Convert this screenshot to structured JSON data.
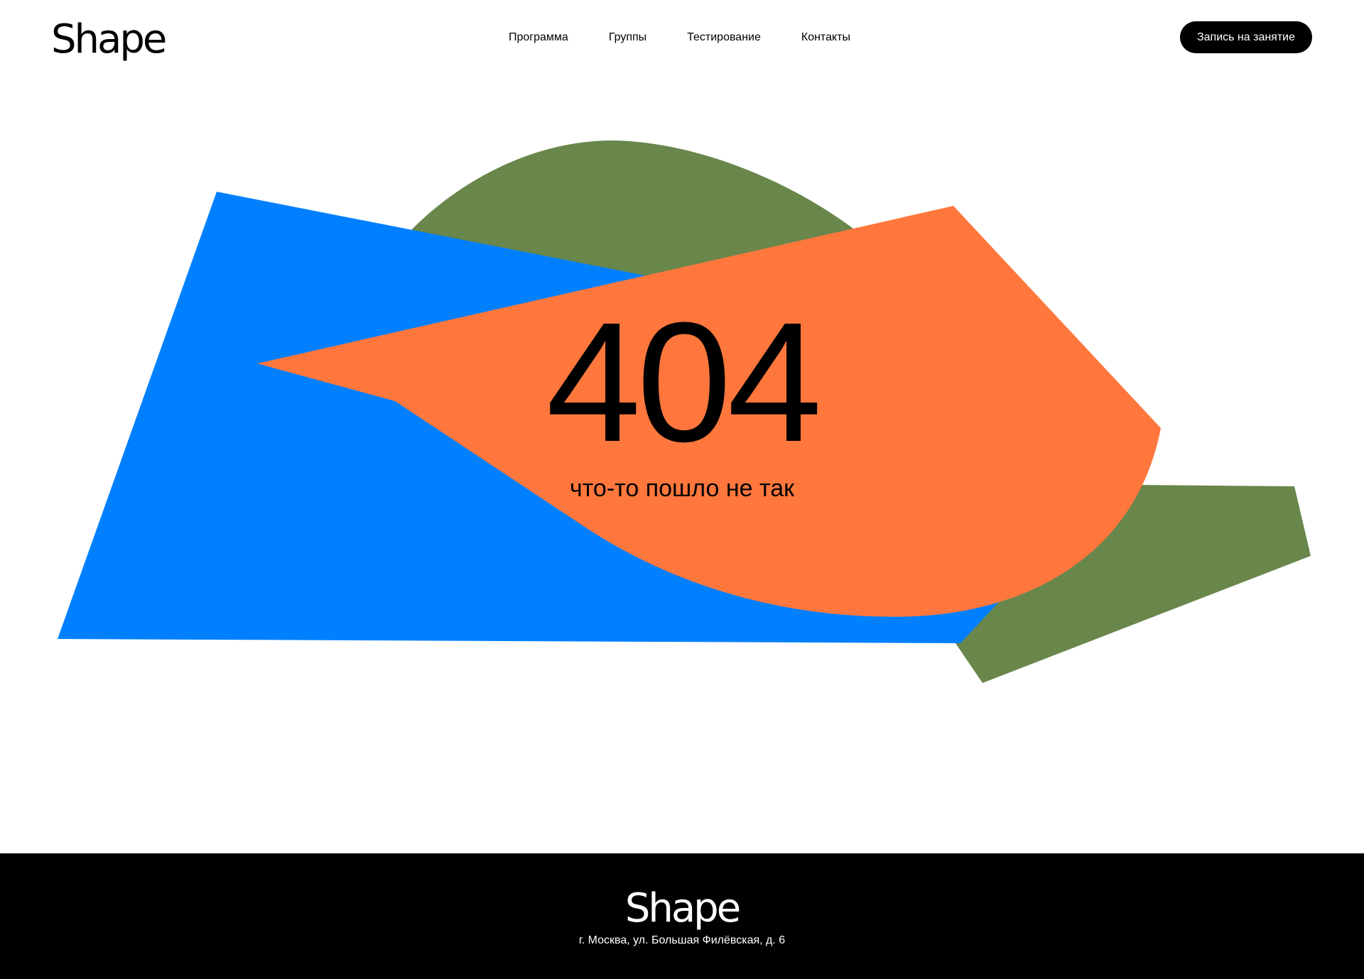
{
  "header": {
    "logo": "Shape",
    "nav": [
      {
        "label": "Программа"
      },
      {
        "label": "Группы"
      },
      {
        "label": "Тестирование"
      },
      {
        "label": "Контакты"
      }
    ],
    "cta_label": "Запись на занятие"
  },
  "hero": {
    "code": "404",
    "message": "что-то пошло не так"
  },
  "footer": {
    "logo": "Shape",
    "address": "г. Москва, ул. Большая Филёвская, д. 6"
  },
  "colors": {
    "blue": "#0080FF",
    "orange": "#FF773D",
    "green": "#69864B",
    "black": "#000000",
    "white": "#FFFFFF"
  }
}
